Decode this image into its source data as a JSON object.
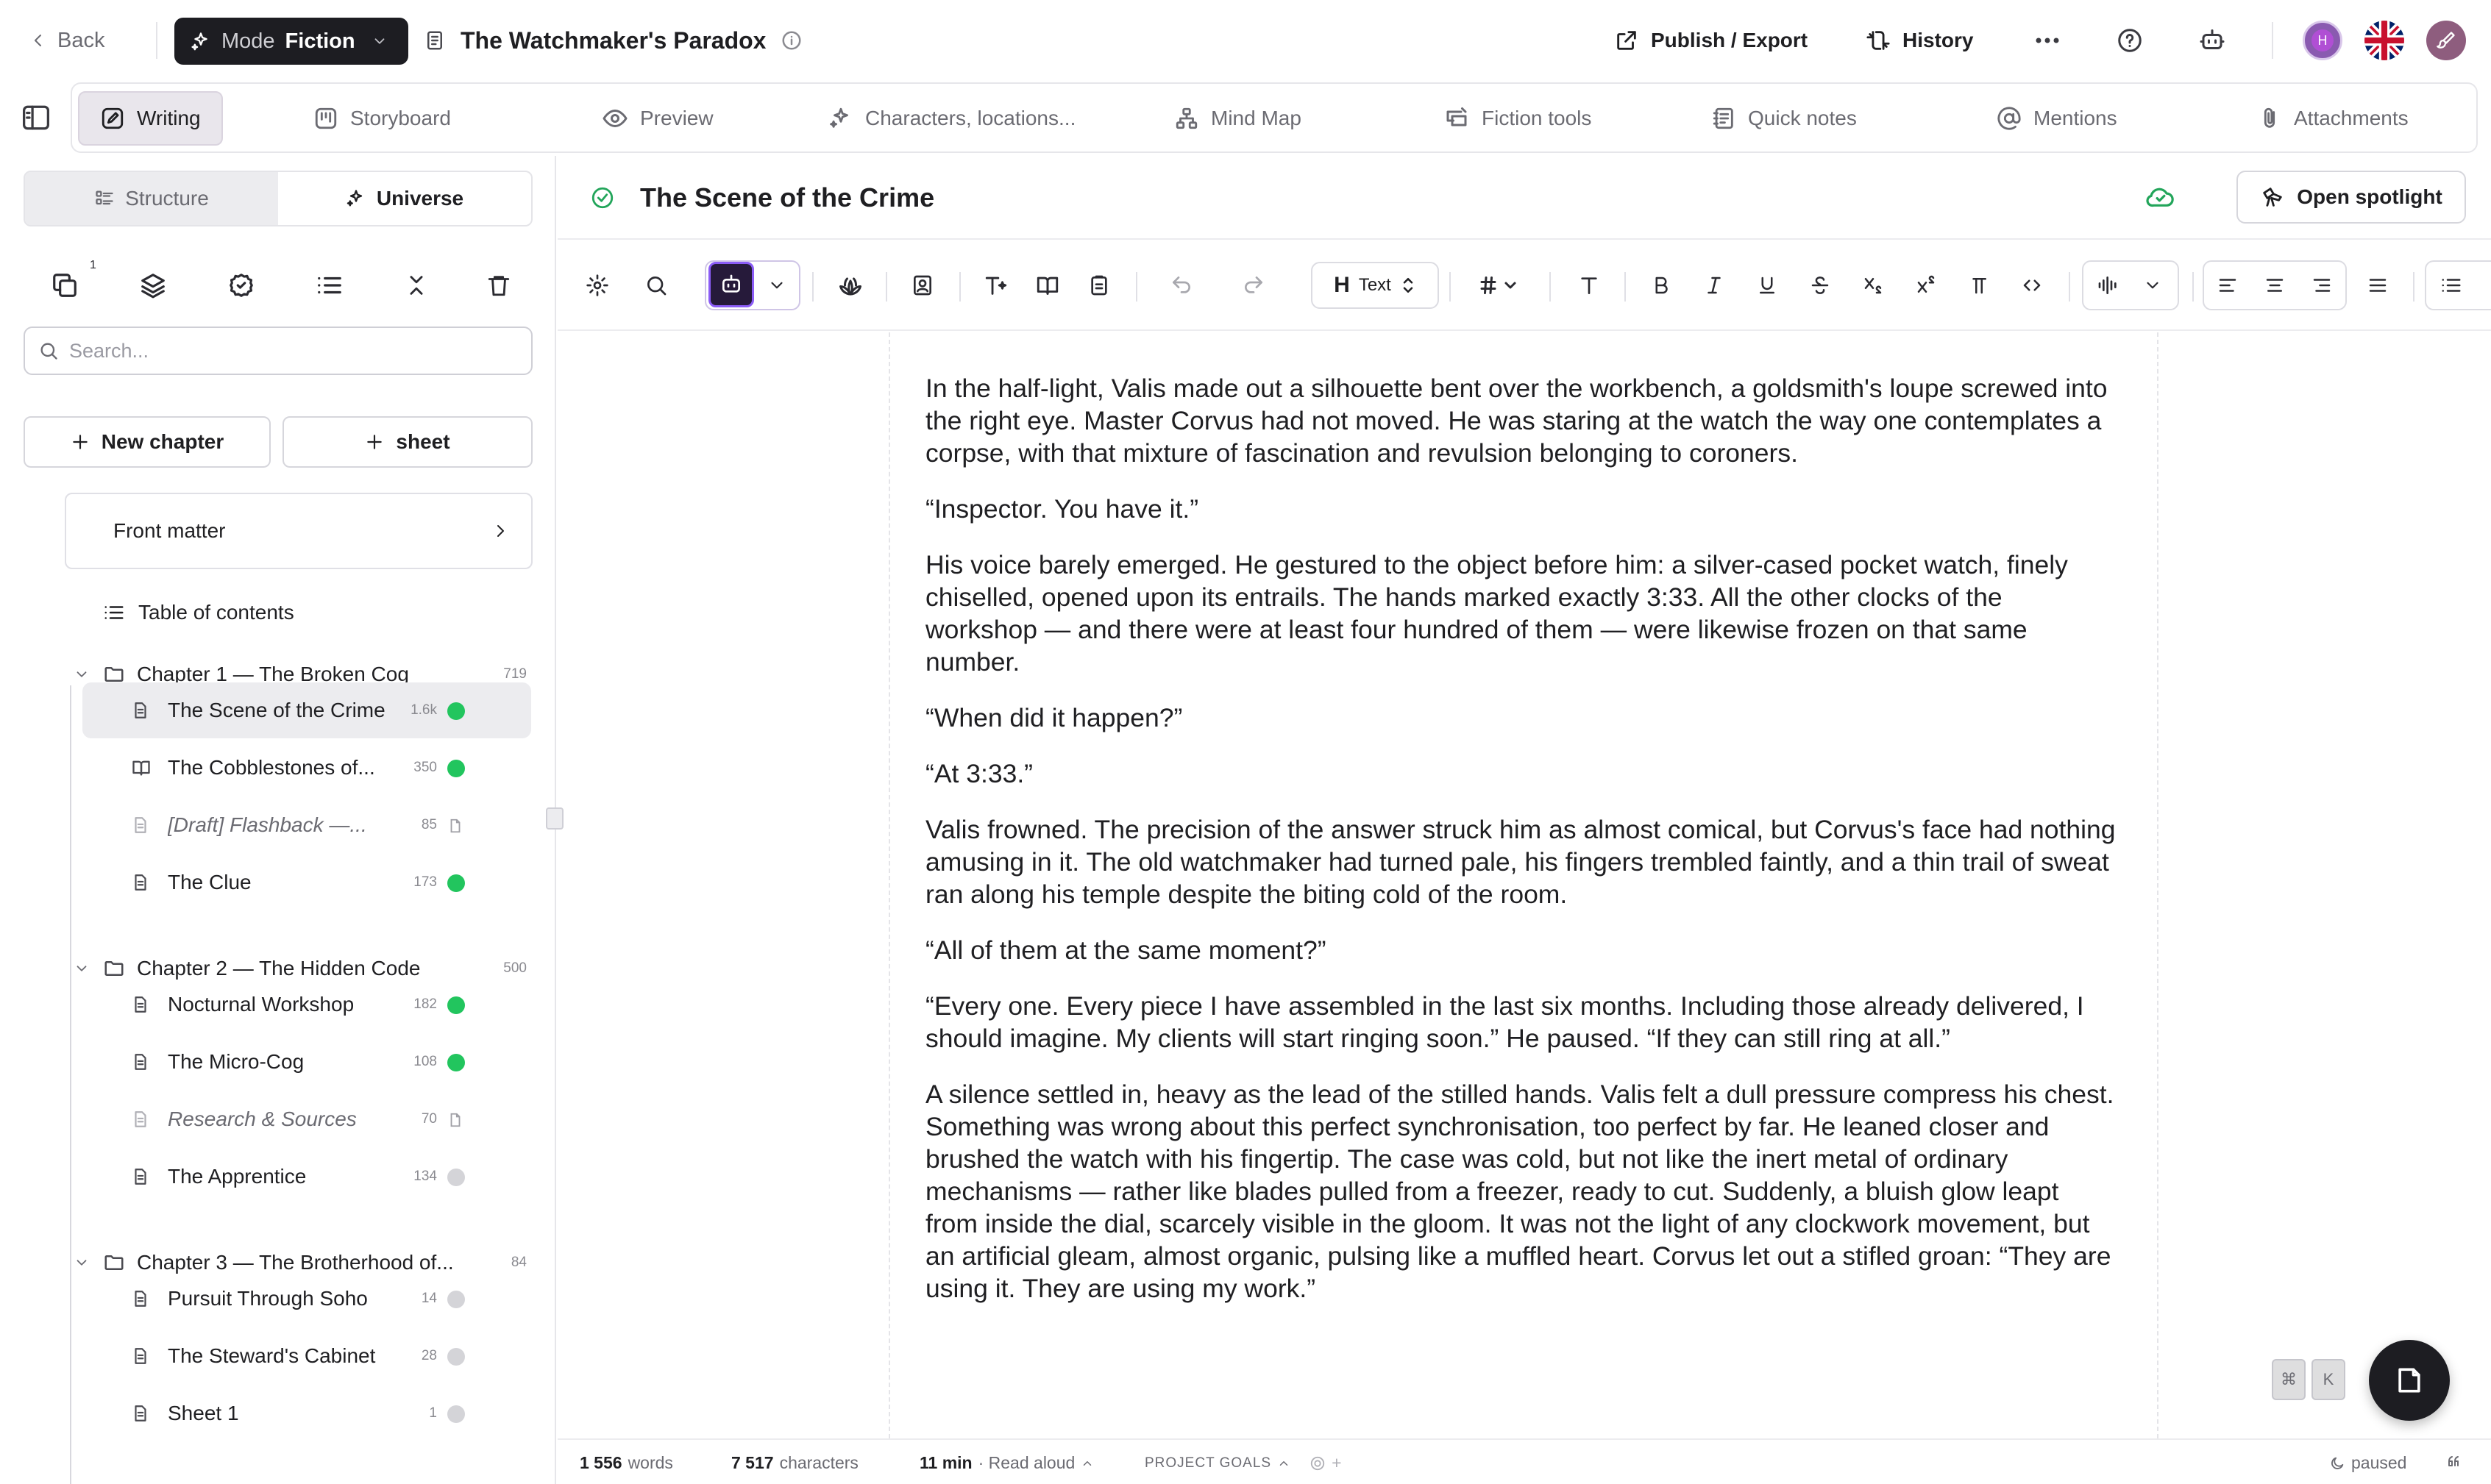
{
  "topbar": {
    "back_label": "Back",
    "mode_word": "Mode",
    "mode_value": "Fiction",
    "doc_title": "The Watchmaker's Paradox",
    "publish_label": "Publish / Export",
    "history_label": "History",
    "avatar_initial": "H"
  },
  "tabs": [
    {
      "label": "Writing",
      "icon": "pen-icon",
      "active": true
    },
    {
      "label": "Storyboard",
      "icon": "storyboard-icon"
    },
    {
      "label": "Preview",
      "icon": "eye-icon"
    },
    {
      "label": "Characters, locations...",
      "icon": "sparkle-icon"
    },
    {
      "label": "Mind Map",
      "icon": "mindmap-icon"
    },
    {
      "label": "Fiction tools",
      "icon": "tools-icon"
    },
    {
      "label": "Quick notes",
      "icon": "notes-icon"
    },
    {
      "label": "Mentions",
      "icon": "at-icon"
    },
    {
      "label": "Attachments",
      "icon": "paperclip-icon"
    }
  ],
  "sidebar": {
    "segments": {
      "structure": "Structure",
      "universe": "Universe"
    },
    "tool_badge": "1",
    "search_placeholder": "Search...",
    "new_chapter_label": "New chapter",
    "new_sheet_label": "sheet",
    "front_matter_label": "Front matter",
    "toc_label": "Table of contents",
    "chapters": [
      {
        "name": "Chapter 1 — The Broken Cog",
        "count": "719",
        "docs": [
          {
            "name": "The Scene of the Crime",
            "count": "1.6k",
            "status": "green",
            "selected": true
          },
          {
            "name": "The Cobblestones of...",
            "count": "350",
            "status": "green",
            "icon": "book-icon"
          },
          {
            "name": "[Draft] Flashback —...",
            "count": "85",
            "status": "page",
            "draft": true
          },
          {
            "name": "The Clue",
            "count": "173",
            "status": "green"
          }
        ]
      },
      {
        "name": "Chapter 2 — The Hidden Code",
        "count": "500",
        "docs": [
          {
            "name": "Nocturnal Workshop",
            "count": "182",
            "status": "green"
          },
          {
            "name": "The Micro-Cog",
            "count": "108",
            "status": "green"
          },
          {
            "name": "Research & Sources",
            "count": "70",
            "status": "page",
            "draft": true
          },
          {
            "name": "The Apprentice",
            "count": "134",
            "status": "grey"
          }
        ]
      },
      {
        "name": "Chapter 3 — The Brotherhood of...",
        "count": "84",
        "docs": [
          {
            "name": "Pursuit Through Soho",
            "count": "14",
            "status": "grey"
          },
          {
            "name": "The Steward's Cabinet",
            "count": "28",
            "status": "grey"
          },
          {
            "name": "Sheet 1",
            "count": "1",
            "status": "grey"
          }
        ]
      }
    ]
  },
  "editor": {
    "scene_title": "The Scene of the Crime",
    "spotlight_label": "Open spotlight",
    "text_style_label": "Text",
    "text_style_glyph": "H",
    "paragraphs": [
      "In the half-light, Valis made out a silhouette bent over the workbench, a goldsmith's loupe screwed into the right eye. Master Corvus had not moved. He was staring at the watch the way one contemplates a corpse, with that mixture of fascination and revulsion belonging to coroners.",
      "“Inspector. You have it.”",
      "His voice barely emerged. He gestured to the object before him: a silver-cased pocket watch, finely chiselled, opened upon its entrails. The hands marked exactly 3:33. All the other clocks of the workshop — and there were at least four hundred of them — were likewise frozen on that same number.",
      "“When did it happen?”",
      "“At 3:33.”",
      "Valis frowned. The precision of the answer struck him as almost comical, but Corvus's face had nothing amusing in it. The old watchmaker had turned pale, his fingers trembled faintly, and a thin trail of sweat ran along his temple despite the biting cold of the room.",
      "“All of them at the same moment?”",
      "“Every one. Every piece I have assembled in the last six months. Including those already delivered, I should imagine. My clients will start ringing soon.” He paused. “If they can still ring at all.”",
      "A silence settled in, heavy as the lead of the stilled hands. Valis felt a dull pressure compress his chest. Something was wrong about this perfect synchronisation, too perfect by far. He leaned closer and brushed the watch with his fingertip. The case was cold, but not like the inert metal of ordinary mechanisms — rather like blades pulled from a freezer, ready to cut. Suddenly, a bluish glow leapt from inside the dial, scarcely visible in the gloom. It was not the light of any clockwork movement, but an artificial gleam, almost organic, pulsing like a muffled heart. Corvus let out a stifled groan: “They are using it. They are using my work.”"
    ]
  },
  "shortcut": {
    "k1": "⌘",
    "k2": "K"
  },
  "statusbar": {
    "words_value": "1 556",
    "words_label": "words",
    "chars_value": "7 517",
    "chars_label": "characters",
    "read_value": "11 min",
    "read_label": "· Read aloud",
    "goals_label": "PROJECT GOALS",
    "plus": "+",
    "timer_label": "paused"
  },
  "colors": {
    "accent_green": "#22c55e",
    "ai_purple": "#8b5cf6",
    "dark": "#1d1d22"
  }
}
